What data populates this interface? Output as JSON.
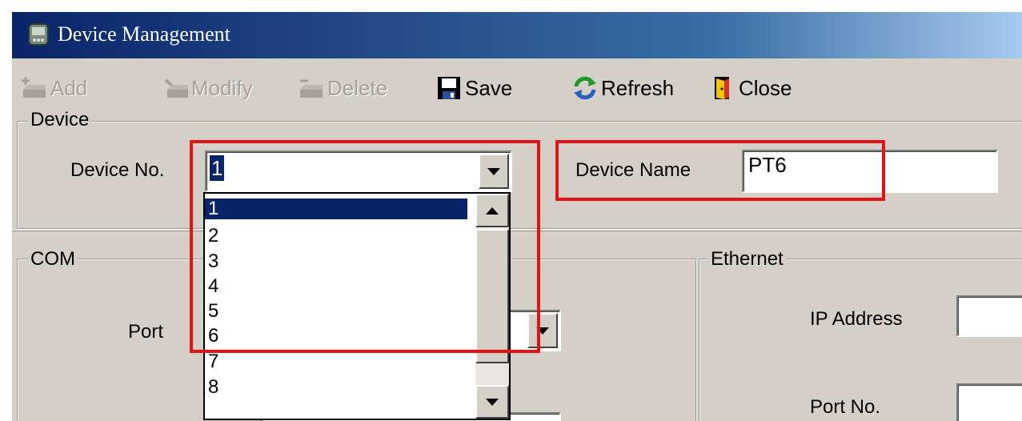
{
  "window": {
    "title": "Device Management"
  },
  "toolbar": {
    "add_label": "Add",
    "modify_label": "Modify",
    "delete_label": "Delete",
    "save_label": "Save",
    "refresh_label": "Refresh",
    "close_label": "Close"
  },
  "device_group": {
    "label": "Device",
    "device_no_label": "Device No.",
    "device_no_value": "1",
    "device_name_label": "Device Name",
    "device_name_value": "PT6"
  },
  "dropdown": {
    "options": [
      "1",
      "2",
      "3",
      "4",
      "5",
      "6",
      "7",
      "8"
    ],
    "selected": "1"
  },
  "com_group": {
    "label": "COM",
    "port_label": "Port"
  },
  "ethernet_group": {
    "label": "Ethernet",
    "ip_address_label": "IP Address",
    "port_no_label": "Port No."
  },
  "colors": {
    "titlebar_start": "#0a246a",
    "titlebar_end": "#a6caf0",
    "highlight_red": "#e31313",
    "selection": "#0a246a",
    "face": "#d4d0c8"
  },
  "icons": {
    "app": "device-app-icon",
    "add": "add-device-icon",
    "modify": "modify-device-icon",
    "delete": "delete-device-icon",
    "save": "floppy-disk-icon",
    "refresh": "refresh-arrows-icon",
    "close": "door-exit-icon"
  }
}
